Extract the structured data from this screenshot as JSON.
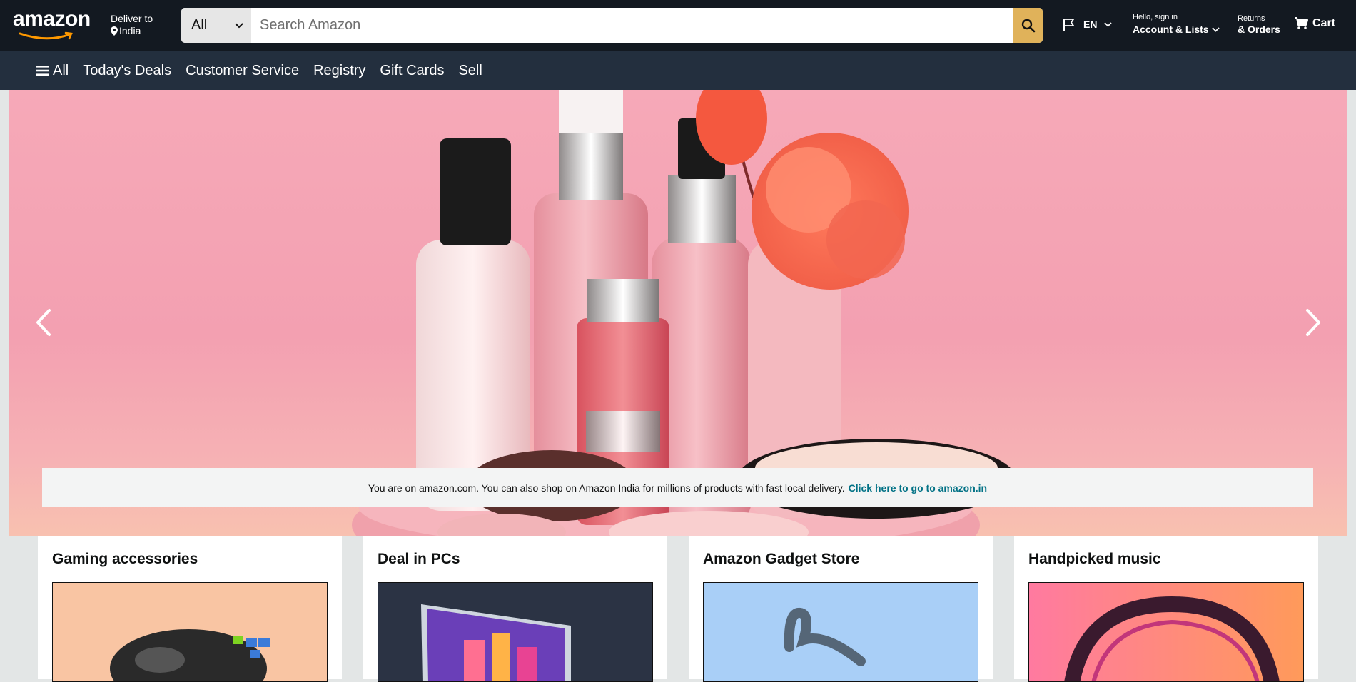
{
  "header": {
    "logo_text": "amazon",
    "deliver_line1": "Deliver to",
    "deliver_line2": "India",
    "search_category": "All",
    "search_placeholder": "Search Amazon",
    "language": "EN",
    "account_line1": "Hello, sign in",
    "account_line2": "Account & Lists",
    "returns_line1": "Returns",
    "returns_line2": "& Orders",
    "cart_label": "Cart"
  },
  "subnav": {
    "items": [
      "All",
      "Today's Deals",
      "Customer Service",
      "Registry",
      "Gift Cards",
      "Sell"
    ]
  },
  "hero": {
    "notice_text": "You are on amazon.com. You can also shop on Amazon India for millions of products with fast local delivery.",
    "notice_link": "Click here to go to amazon.in"
  },
  "cards": [
    {
      "title": "Gaming accessories",
      "bg": "#f9c5a3"
    },
    {
      "title": "Deal in PCs",
      "bg": "#2b3344"
    },
    {
      "title": "Amazon Gadget Store",
      "bg": "#a9cff7"
    },
    {
      "title": "Handpicked music",
      "bg": "#ff8a70"
    }
  ],
  "colors": {
    "header_bg": "#131921",
    "subnav_bg": "#232f3e",
    "search_button": "#e0b25a",
    "link": "#007185",
    "page_bg": "#e3e6e6"
  }
}
